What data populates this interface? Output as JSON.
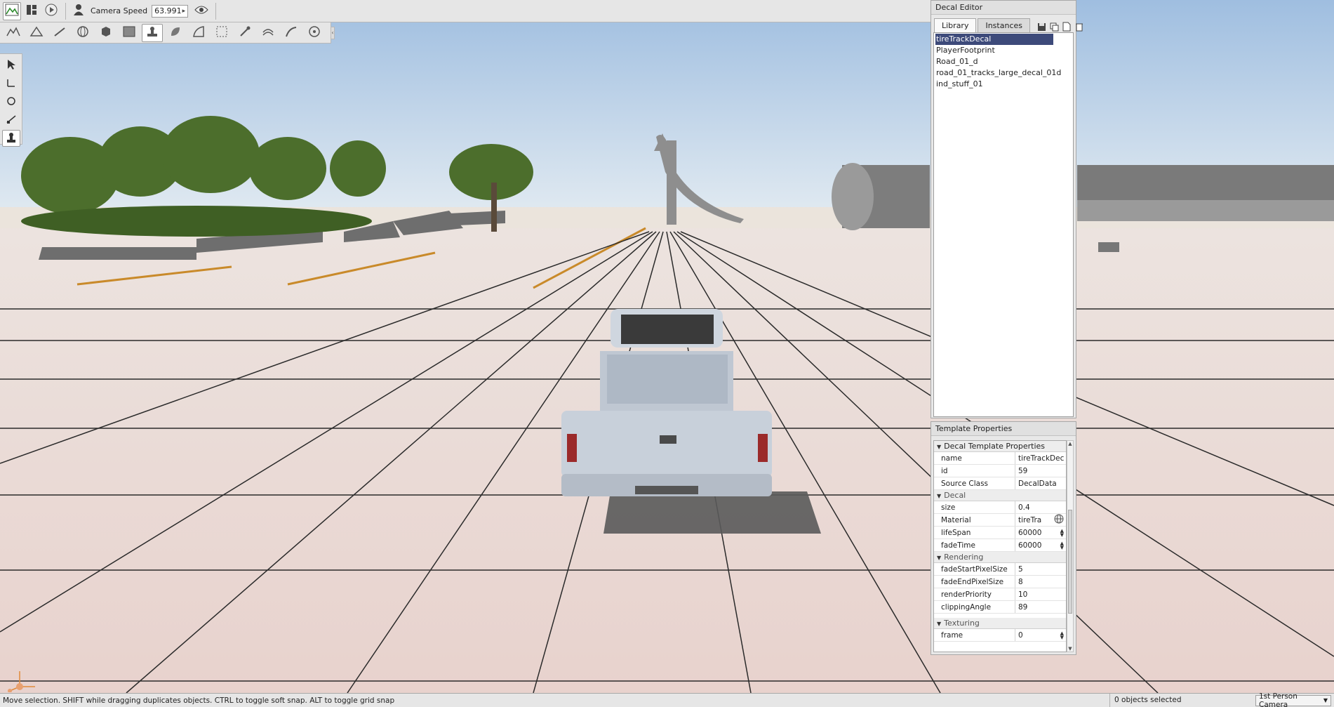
{
  "toolbar": {
    "camera_speed_label": "Camera Speed",
    "camera_speed_value": "63.991"
  },
  "decal_editor": {
    "title": "Decal Editor",
    "tabs": [
      {
        "label": "Library",
        "active": true
      },
      {
        "label": "Instances",
        "active": false
      }
    ],
    "library_items": [
      {
        "label": "tireTrackDecal",
        "selected": true
      },
      {
        "label": "PlayerFootprint",
        "selected": false
      },
      {
        "label": "Road_01_d",
        "selected": false
      },
      {
        "label": "road_01_tracks_large_decal_01d",
        "selected": false
      },
      {
        "label": "ind_stuff_01",
        "selected": false
      }
    ]
  },
  "template_properties": {
    "title": "Template Properties",
    "group_main": "Decal Template Properties",
    "main_rows": [
      {
        "name": "name",
        "value": "tireTrackDec"
      },
      {
        "name": "id",
        "value": "59"
      },
      {
        "name": "Source Class",
        "value": "DecalData"
      }
    ],
    "group_decal": "Decal",
    "decal_rows": [
      {
        "name": "size",
        "value": "0.4"
      },
      {
        "name": "Material",
        "value": "tireTra"
      },
      {
        "name": "lifeSpan",
        "value": "60000"
      },
      {
        "name": "fadeTime",
        "value": "60000"
      }
    ],
    "group_rendering": "Rendering",
    "rendering_rows": [
      {
        "name": "fadeStartPixelSize",
        "value": "5"
      },
      {
        "name": "fadeEndPixelSize",
        "value": "8"
      },
      {
        "name": "renderPriority",
        "value": "10"
      },
      {
        "name": "clippingAngle",
        "value": "89"
      }
    ],
    "group_texturing": "Texturing",
    "texturing_rows": [
      {
        "name": "frame",
        "value": "0"
      }
    ]
  },
  "status_bar": {
    "message": "Move selection.  SHIFT while dragging duplicates objects.  CTRL to toggle soft snap.  ALT to toggle grid snap",
    "objects_selected": "0 objects selected",
    "camera_mode": "1st Person Camera"
  },
  "colors": {
    "sky_top": "#9fbee0",
    "ground": "#e9d7d2",
    "selection": "#3d4a7a",
    "truck": "#c9d0da"
  }
}
